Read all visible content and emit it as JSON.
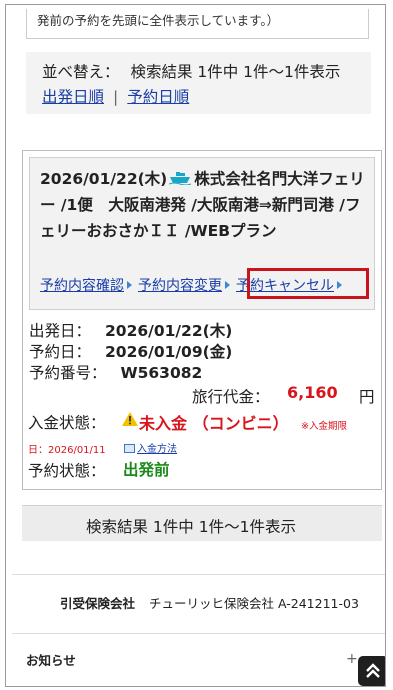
{
  "top_note": "発前の予約を先頭に全件表示しています。）",
  "sort": {
    "label": "並べ替え：",
    "result_summary": "検索結果 1件中 1件〜1件表示",
    "links": [
      "出発日順",
      "予約日順"
    ],
    "separator": "|"
  },
  "reservation": {
    "title_date": "2026/01/22(木)",
    "title_rest": "株式会社名門大洋フェリー /1便　大阪南港発 /大阪南港⇒新門司港 /フェリーおおさかＩＩ /WEBプラン",
    "ship_icon": "ship-icon",
    "actions": {
      "confirm": "予約内容確認",
      "change": "予約内容変更",
      "cancel": "予約キャンセル"
    },
    "highlight_color": "#c8141c",
    "departure_label": "出発日：",
    "departure_value": "2026/01/22(木)",
    "booking_label": "予約日：",
    "booking_value": "2026/01/09(金)",
    "number_label": "予約番号：",
    "number_value": "W563082",
    "price_label": "旅行代金：",
    "price_value": "6,160",
    "price_unit": "円",
    "payment_label": "入金状態：",
    "payment_value": "未入金 （コンビニ）",
    "payment_deadline_note": "※入金期限",
    "payment_due": "日：2026/01/11",
    "payment_method_link": "入金方法",
    "status_label": "予約状態：",
    "status_value": "出発前",
    "status_color": "#1a8a1a",
    "alert_color": "#d8141c"
  },
  "summary": "検索結果 1件中 1件〜1件表示",
  "footer": {
    "insurer_label": "引受保険会社",
    "insurer_value": "チューリッヒ保険会社 A-241211-03",
    "news_label": "お知らせ",
    "expand_symbol": "+",
    "scroll_top_icon": "double-chevron-up-icon"
  }
}
